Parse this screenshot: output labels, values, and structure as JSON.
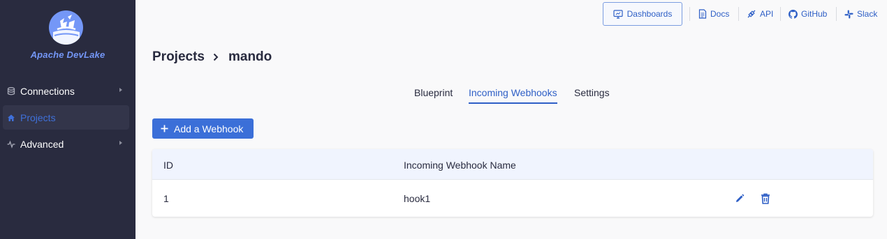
{
  "sidebar": {
    "brand": "Apache DevLake",
    "items": [
      {
        "label": "Connections",
        "icon": "database-icon"
      },
      {
        "label": "Projects",
        "icon": "home-icon",
        "active": true
      },
      {
        "label": "Advanced",
        "icon": "pulse-icon"
      }
    ]
  },
  "header": {
    "dashboards_label": "Dashboards",
    "links": [
      {
        "label": "Docs",
        "icon": "document-icon"
      },
      {
        "label": "API",
        "icon": "api-icon"
      },
      {
        "label": "GitHub",
        "icon": "github-icon"
      },
      {
        "label": "Slack",
        "icon": "slack-icon"
      }
    ]
  },
  "breadcrumb": {
    "parent": "Projects",
    "current": "mando"
  },
  "tabs": [
    {
      "label": "Blueprint"
    },
    {
      "label": "Incoming Webhooks",
      "active": true
    },
    {
      "label": "Settings"
    }
  ],
  "add_button_label": "Add a Webhook",
  "table": {
    "columns": [
      "ID",
      "Incoming Webhook Name"
    ],
    "rows": [
      {
        "id": "1",
        "name": "hook1"
      }
    ]
  },
  "colors": {
    "sidebar_bg": "#292b3f",
    "accent": "#2e5fc6",
    "primary_button": "#3b6fd8",
    "logo": "#7497f7"
  }
}
